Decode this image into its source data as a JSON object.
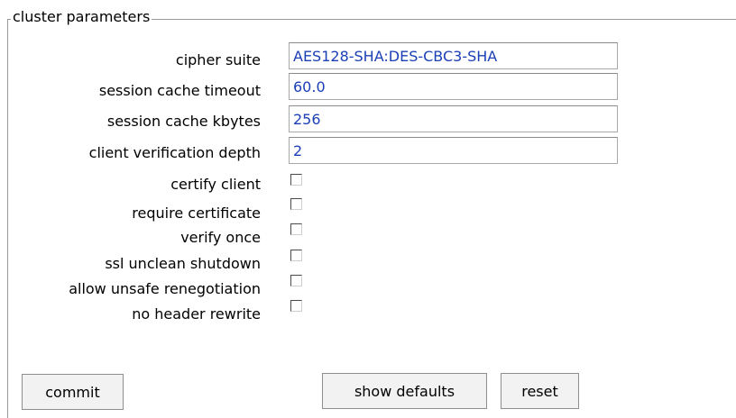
{
  "legend": "cluster parameters",
  "fields": {
    "cipher_suite": {
      "label": "cipher suite",
      "value": "AES128-SHA:DES-CBC3-SHA"
    },
    "session_cache_timeout": {
      "label": "session cache timeout",
      "value": "60.0"
    },
    "session_cache_kbytes": {
      "label": "session cache kbytes",
      "value": "256"
    },
    "client_verification_depth": {
      "label": "client verification depth",
      "value": "2"
    }
  },
  "checkboxes": {
    "certify_client": {
      "label": "certify client",
      "checked": false
    },
    "require_certificate": {
      "label": "require certificate",
      "checked": false
    },
    "verify_once": {
      "label": "verify once",
      "checked": false
    },
    "ssl_unclean_shutdown": {
      "label": "ssl unclean shutdown",
      "checked": false
    },
    "allow_unsafe_renegotiation": {
      "label": "allow unsafe renegotiation",
      "checked": false
    },
    "no_header_rewrite": {
      "label": "no header rewrite",
      "checked": false
    }
  },
  "buttons": {
    "commit": "commit",
    "show_defaults": "show defaults",
    "reset": "reset"
  },
  "colors": {
    "input_text": "#1b3fb5",
    "frame_border": "#9a9a9a",
    "button_bg": "#f2f2f2"
  }
}
